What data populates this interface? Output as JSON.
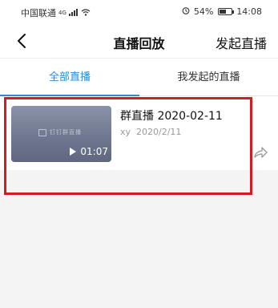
{
  "status_bar": {
    "carrier": "中国联通",
    "network": "4G",
    "battery": "54%",
    "battery_level": 0.54,
    "time": "14:08"
  },
  "header": {
    "back_icon": "chevron-left-icon",
    "title": "直播回放",
    "action_label": "发起直播"
  },
  "tabs": [
    {
      "label": "全部直播",
      "active": true
    },
    {
      "label": "我发起的直播",
      "active": false
    }
  ],
  "items": [
    {
      "thumbnail_logo_text": "钉钉群直播",
      "duration": "01:07",
      "title": "群直播 2020-02-11",
      "author": "xy",
      "date": "2020/2/11"
    }
  ],
  "colors": {
    "accent": "#2a8cd8",
    "highlight": "#d21c22"
  }
}
